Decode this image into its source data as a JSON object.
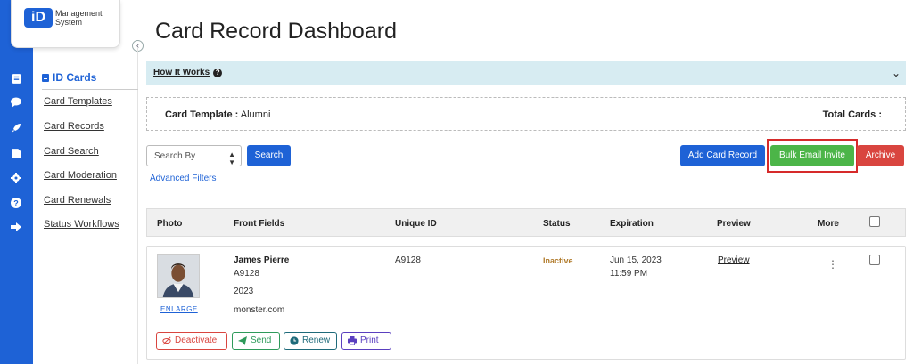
{
  "brand": {
    "logo_mark": "iD",
    "logo_line1": "Management",
    "logo_line2": "System",
    "color": "#1e62d6"
  },
  "iconbar": [
    "id-card-icon",
    "chat-icon",
    "rocket-icon",
    "document-icon",
    "gear-icon",
    "help-icon",
    "logout-icon"
  ],
  "sidebar": {
    "heading": "ID Cards",
    "items": [
      {
        "label": "Card Templates"
      },
      {
        "label": "Card Records"
      },
      {
        "label": "Card Search"
      },
      {
        "label": "Card Moderation"
      },
      {
        "label": "Card Renewals"
      },
      {
        "label": "Status Workflows"
      }
    ]
  },
  "page": {
    "title": "Card Record Dashboard"
  },
  "how_it_works": {
    "label": "How It Works"
  },
  "template_info": {
    "label": "Card Template :",
    "value": "Alumni",
    "total_label": "Total Cards :"
  },
  "toolbar": {
    "search_by": "Search By",
    "search_button": "Search",
    "advanced_filters": "Advanced Filters",
    "add_button": "Add Card Record",
    "bulk_email_button": "Bulk Email Invite",
    "archive_button": "Archive"
  },
  "table": {
    "headers": [
      "Photo",
      "Front Fields",
      "Unique ID",
      "Status",
      "Expiration",
      "Preview",
      "More"
    ],
    "rows": [
      {
        "enlarge": "ENLARGE",
        "name": "James Pierre",
        "field1": "A9128",
        "field2": "2023",
        "field3": "monster.com",
        "unique_id": "A9128",
        "status": "Inactive",
        "exp_date": "Jun 15, 2023",
        "exp_time": "11:59 PM",
        "preview": "Preview",
        "actions": {
          "deactivate": "Deactivate",
          "send": "Send",
          "renew": "Renew",
          "print": "Print"
        }
      }
    ]
  }
}
